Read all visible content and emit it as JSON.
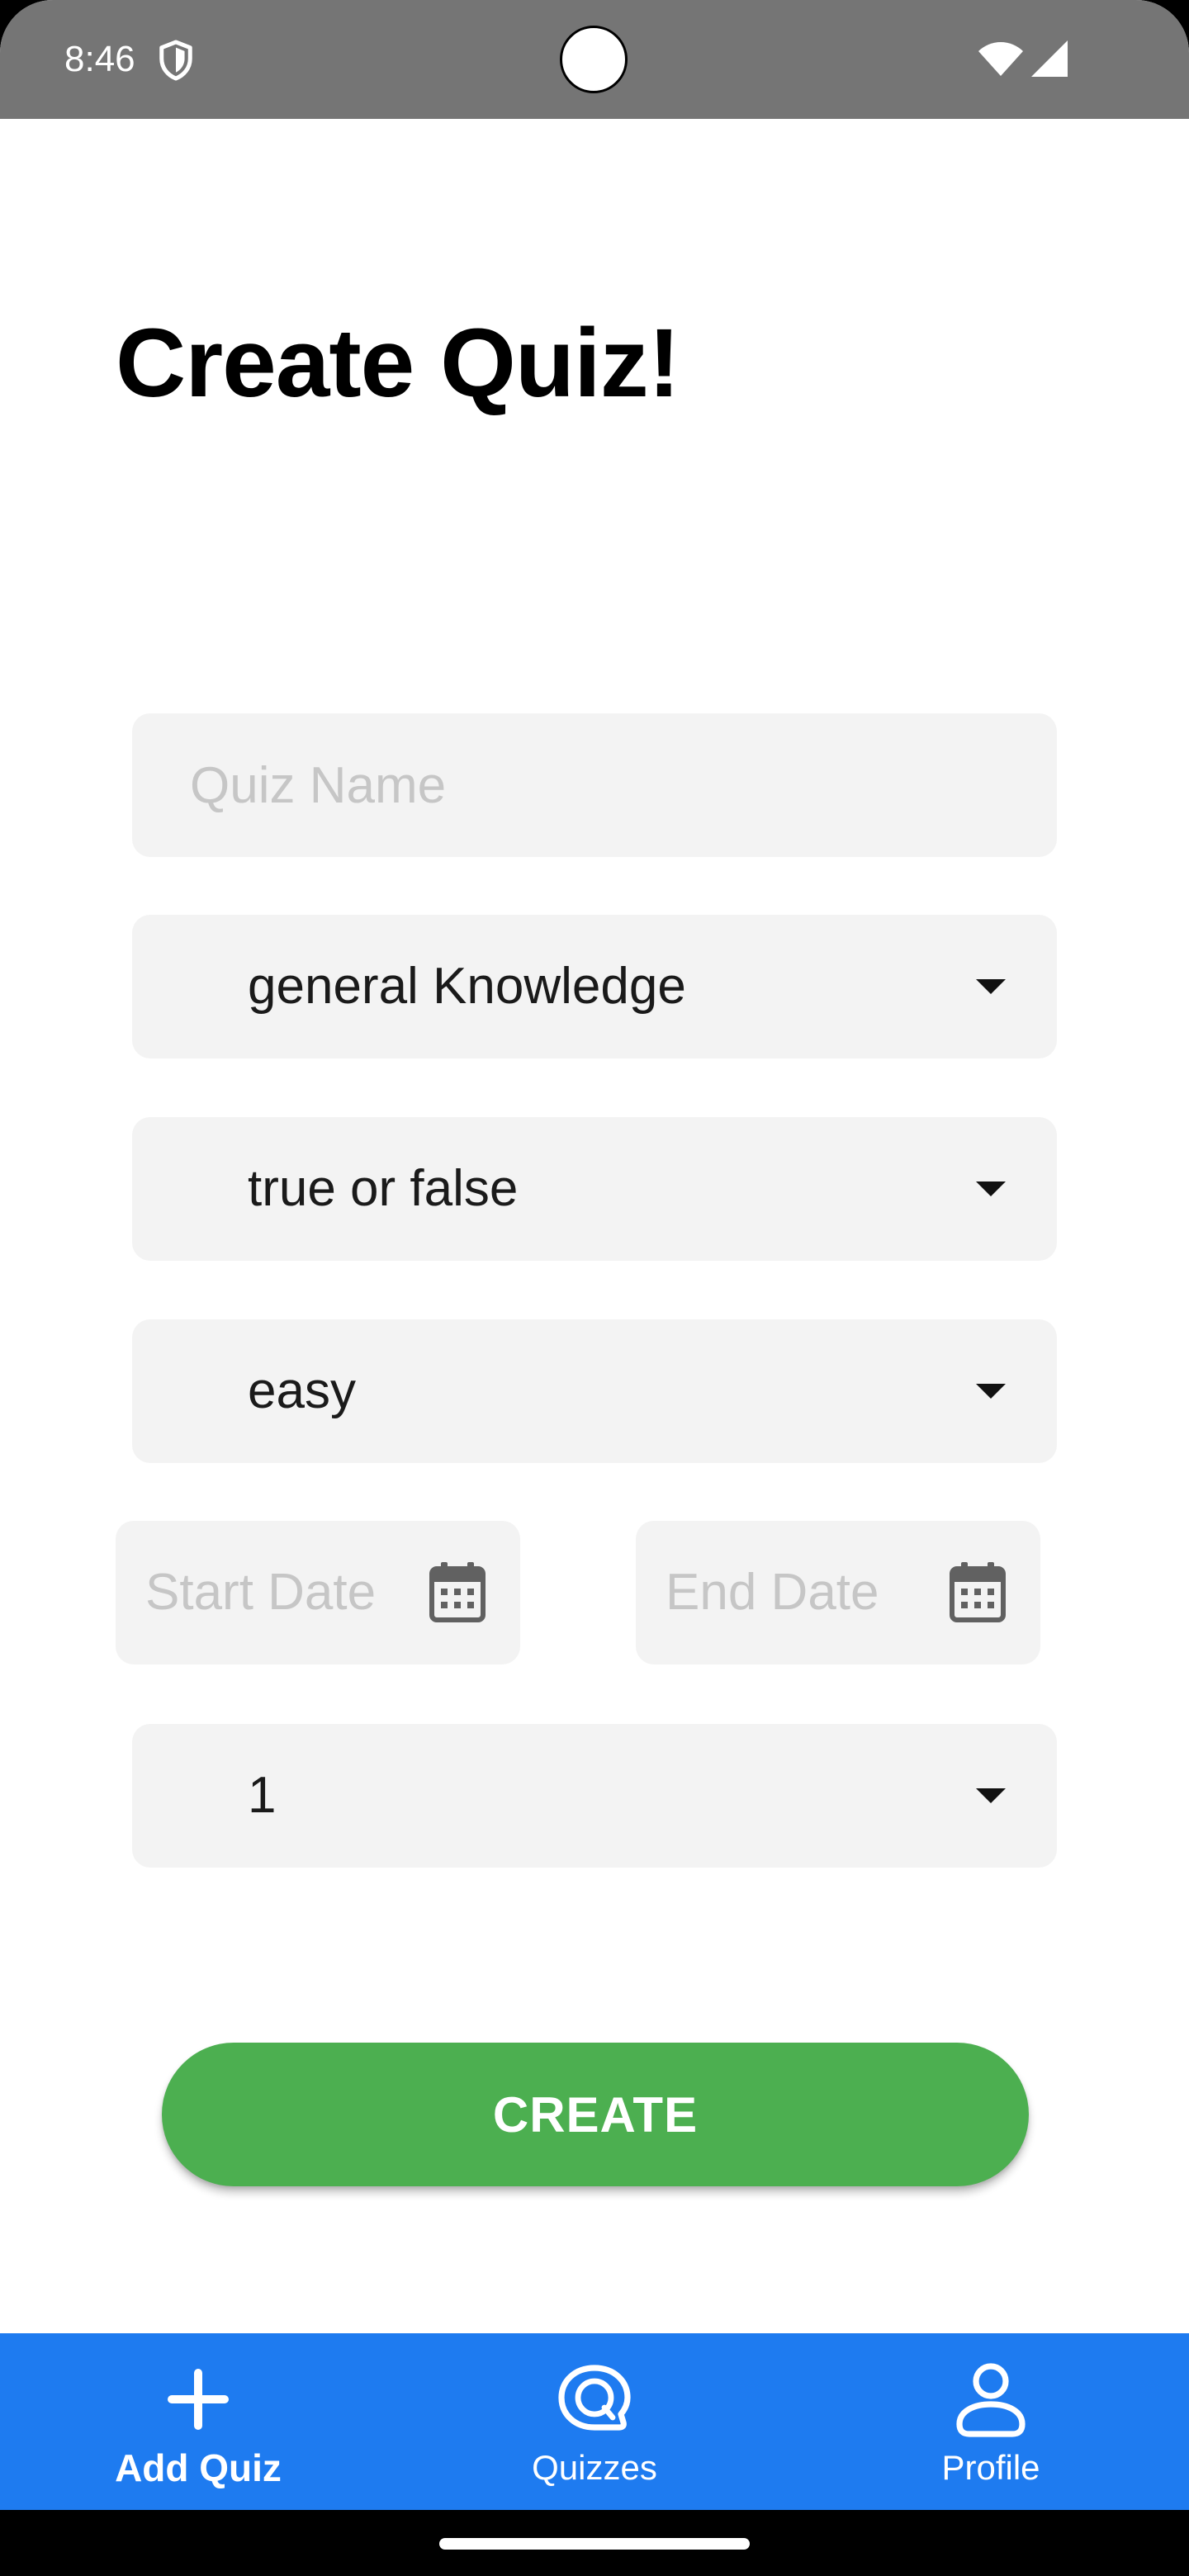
{
  "status_bar": {
    "time": "8:46",
    "icons": [
      "shield-icon",
      "wifi-icon",
      "signal-icon"
    ]
  },
  "page": {
    "title": "Create Quiz!"
  },
  "form": {
    "quiz_name": {
      "placeholder": "Quiz Name",
      "value": ""
    },
    "category": {
      "selected": "general Knowledge"
    },
    "question_type": {
      "selected": "true or false"
    },
    "difficulty": {
      "selected": "easy"
    },
    "start_date": {
      "placeholder": "Start Date",
      "icon": "calendar-icon"
    },
    "end_date": {
      "placeholder": "End Date",
      "icon": "calendar-icon"
    },
    "question_count": {
      "selected": "1"
    },
    "create_label": "CREATE"
  },
  "bottom_nav": {
    "items": [
      {
        "label": "Add Quiz",
        "icon": "plus-icon",
        "active": true
      },
      {
        "label": "Quizzes",
        "icon": "chat-bubble-icon",
        "active": false
      },
      {
        "label": "Profile",
        "icon": "person-icon",
        "active": false
      }
    ]
  },
  "colors": {
    "status_bar": "#757575",
    "field_background": "#f3f3f3",
    "placeholder": "#c6c6c6",
    "create_button": "#4caf50",
    "bottom_nav": "#1e7bf0"
  }
}
